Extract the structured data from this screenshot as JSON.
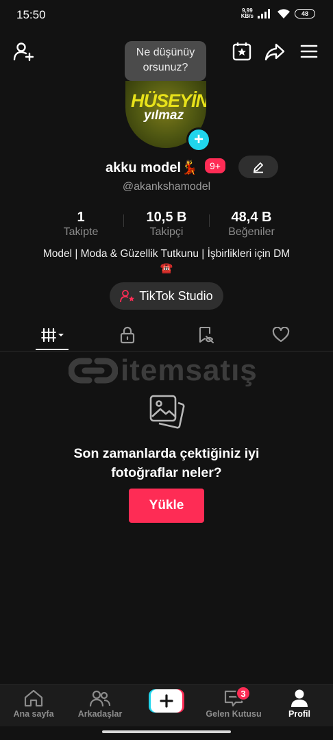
{
  "status_bar": {
    "time": "15:50",
    "net_speed_value": "9,99",
    "net_speed_unit": "KB/s",
    "battery": "48"
  },
  "tooltip": {
    "line1": "Ne düşünüy",
    "line2": "orsunuz?"
  },
  "avatar": {
    "line1": "HÜSEYİN",
    "line2": "yılmaz"
  },
  "profile": {
    "name": "akku model💃",
    "notification_badge": "9+",
    "handle": "@akankshamodel",
    "bio": "Model | Moda & Güzellik Tutkunu | İşbirlikleri için DM",
    "bio_emoji": "☎️"
  },
  "stats": [
    {
      "value": "1",
      "label": "Takipte"
    },
    {
      "value": "10,5 B",
      "label": "Takipçi"
    },
    {
      "value": "48,4 B",
      "label": "Beğeniler"
    }
  ],
  "studio_button": "TikTok Studio",
  "watermark": "itemsatış",
  "empty_state": {
    "title_line1": "Son zamanlarda çektiğiniz iyi",
    "title_line2": "fotoğraflar neler?",
    "button": "Yükle"
  },
  "bottom_nav": {
    "home": "Ana sayfa",
    "friends": "Arkadaşlar",
    "create": "+",
    "inbox": "Gelen Kutusu",
    "inbox_badge": "3",
    "profile": "Profil"
  },
  "colors": {
    "accent": "#fe2c55",
    "cyan": "#20d5ec",
    "background": "#121212"
  }
}
